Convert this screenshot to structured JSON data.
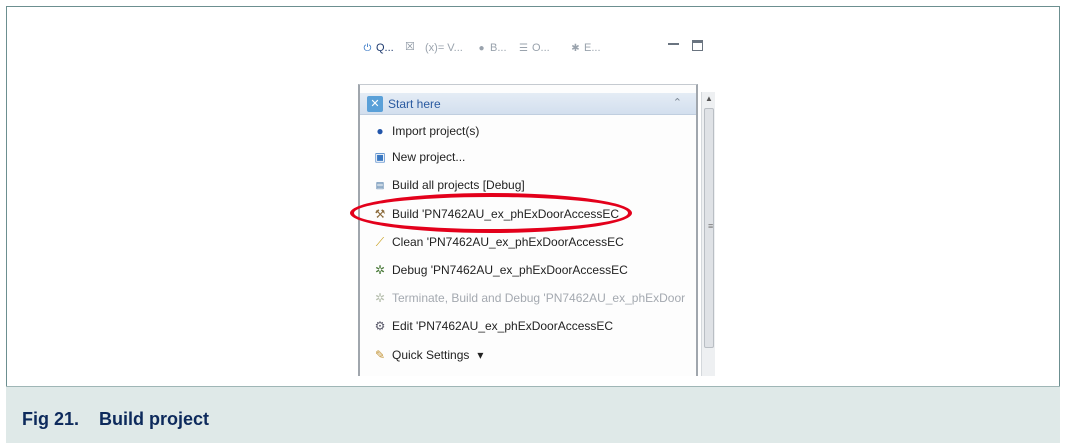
{
  "tabs": {
    "items": [
      {
        "label": "Q...",
        "icon": "power-icon"
      },
      {
        "label": "(x)= V...",
        "icon": "variables-icon"
      },
      {
        "label": "B...",
        "icon": "breakpoints-icon"
      },
      {
        "label": "O...",
        "icon": "outline-icon"
      },
      {
        "label": "E...",
        "icon": "expressions-icon"
      }
    ],
    "close_symbol": "☒"
  },
  "section": {
    "title": "Start here",
    "collapse_symbol": "⌃"
  },
  "menu": [
    {
      "label": "Import project(s)",
      "icon": "bulb-icon",
      "enabled": true
    },
    {
      "label": "New project...",
      "icon": "new-project-icon",
      "enabled": true
    },
    {
      "label": "Build all projects [Debug]",
      "icon": "build-all-icon",
      "enabled": true
    },
    {
      "label": "Build 'PN7462AU_ex_phExDoorAccessEC",
      "icon": "hammer-icon",
      "enabled": true
    },
    {
      "label": "Clean 'PN7462AU_ex_phExDoorAccessEC",
      "icon": "broom-icon",
      "enabled": true
    },
    {
      "label": "Debug 'PN7462AU_ex_phExDoorAccessEC",
      "icon": "bug-icon",
      "enabled": true
    },
    {
      "label": "Terminate, Build and Debug 'PN7462AU_ex_phExDoor",
      "icon": "bug-icon",
      "enabled": false
    },
    {
      "label": "Edit 'PN7462AU_ex_phExDoorAccessEC",
      "icon": "gear-icon",
      "enabled": true
    },
    {
      "label": "Quick Settings",
      "icon": "settings-icon",
      "enabled": true
    }
  ],
  "dropdown_symbol": "▾",
  "highlight_color": "#e3001b",
  "caption": {
    "number": "Fig 21.",
    "title": "Build project"
  }
}
